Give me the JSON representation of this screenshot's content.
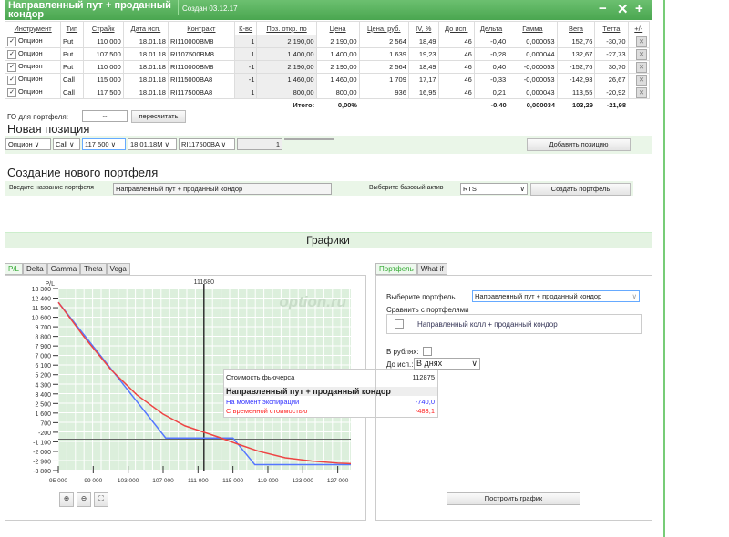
{
  "header": {
    "title": "Направленный пут + проданный кондор",
    "created": "Создан 03.12.17"
  },
  "table": {
    "columns": [
      "Инструмент",
      "Тип",
      "Страйк",
      "Дата исп.",
      "Контракт",
      "К-во",
      "Поз. откр. по",
      "Цена",
      "Цена, руб.",
      "IV, %",
      "До исп.",
      "Дельта",
      "Гамма",
      "Вега",
      "Тетта",
      "+/-"
    ],
    "rows": [
      [
        "Опцион",
        "Put",
        "110 000",
        "18.01.18",
        "RI110000BM8",
        "1",
        "2 190,00",
        "2 190,00",
        "2 564",
        "18,49",
        "46",
        "-0,40",
        "0,000053",
        "152,76",
        "-30,70"
      ],
      [
        "Опцион",
        "Put",
        "107 500",
        "18.01.18",
        "RI107500BM8",
        "1",
        "1 400,00",
        "1 400,00",
        "1 639",
        "19,23",
        "46",
        "-0,28",
        "0,000044",
        "132,67",
        "-27,73"
      ],
      [
        "Опцион",
        "Put",
        "110 000",
        "18.01.18",
        "RI110000BM8",
        "-1",
        "2 190,00",
        "2 190,00",
        "2 564",
        "18,49",
        "46",
        "0,40",
        "-0,000053",
        "-152,76",
        "30,70"
      ],
      [
        "Опцион",
        "Call",
        "115 000",
        "18.01.18",
        "RI115000BA8",
        "-1",
        "1 460,00",
        "1 460,00",
        "1 709",
        "17,17",
        "46",
        "-0,33",
        "-0,000053",
        "-142,93",
        "26,67"
      ],
      [
        "Опцион",
        "Call",
        "117 500",
        "18.01.18",
        "RI117500BA8",
        "1",
        "800,00",
        "800,00",
        "936",
        "16,95",
        "46",
        "0,21",
        "0,000043",
        "113,55",
        "-20,92"
      ]
    ],
    "total_label": "Итого:",
    "total_pct": "0,00%",
    "total_delta": "-0,40",
    "total_gamma": "0,000034",
    "total_vega": "103,29",
    "total_theta": "-21,98"
  },
  "go": {
    "label": "ГО для портфеля:",
    "value": "--",
    "recalc": "пересчитать"
  },
  "new_position": {
    "title": "Новая позиция",
    "instrument": "Опцион",
    "type": "Call",
    "strike": "117 500",
    "date": "18.01.18M",
    "contract": "RI117500BA",
    "qty": "1",
    "add": "Добавить позицию"
  },
  "new_portfolio": {
    "title": "Создание нового портфеля",
    "name_label": "Введите название портфеля",
    "name_value": "Направленный пут + проданный кондор",
    "asset_label": "Выберите базовый актив",
    "asset": "RTS",
    "create": "Создать портфель"
  },
  "charts": {
    "title": "Графики",
    "tabs": [
      "P/L",
      "Delta",
      "Gamma",
      "Theta",
      "Vega"
    ],
    "zoom_icons": [
      "zoom-in",
      "zoom-out",
      "zoom-fit"
    ]
  },
  "chart_data": {
    "type": "line",
    "ylabel": "P/L",
    "watermark": "option.ru",
    "marker": "111680",
    "yticks": [
      13300,
      12400,
      11500,
      10600,
      9700,
      8800,
      7900,
      7000,
      6100,
      5200,
      4300,
      3400,
      2500,
      1600,
      700,
      -200,
      -1100,
      -2000,
      -2900,
      -3800
    ],
    "ytick_labels": [
      "13 300",
      "12 400",
      "11 500",
      "10 600",
      "9 700",
      "8 800",
      "7 900",
      "7 000",
      "6 100",
      "5 200",
      "4 300",
      "3 400",
      "2 500",
      "1 600",
      "700",
      "-200",
      "-1 100",
      "-2 000",
      "-2 900",
      "-3 800"
    ],
    "xticks": [
      95000,
      99000,
      103000,
      107000,
      111000,
      115000,
      119000,
      123000,
      127000
    ],
    "xtick_labels": [
      "95 000",
      "99 000",
      "103 000",
      "107 000",
      "111 000",
      "115 000",
      "119 000",
      "123 000",
      "127 000"
    ],
    "xlim": [
      95000,
      128500
    ],
    "ylim": [
      -3800,
      13300
    ],
    "series": [
      {
        "name": "На момент экспирации",
        "color": "#5577ff",
        "x": [
          95000,
          107300,
          115000,
          117500,
          128500
        ],
        "y": [
          12000,
          -740,
          -740,
          -3240,
          -3240
        ]
      },
      {
        "name": "С временной стоимостью",
        "color": "#ee4444",
        "x": [
          95000,
          98000,
          101000,
          104000,
          107000,
          109500,
          111680,
          113500,
          115500,
          118000,
          121000,
          124000,
          127000,
          128500
        ],
        "y": [
          12000,
          8700,
          5700,
          3300,
          1500,
          400,
          -200,
          -700,
          -1300,
          -2000,
          -2600,
          -2900,
          -3100,
          -3150
        ]
      }
    ],
    "tooltip": {
      "label": "Стоимость фьючерса",
      "x": "112875",
      "title": "Направленный пут + проданный кондор",
      "expiry_label": "На момент экспирации",
      "expiry_value": "-740,0",
      "time_label": "С временной стоимостью",
      "time_value": "-483,1"
    }
  },
  "side": {
    "tabs": [
      "Портфель",
      "What if"
    ],
    "select_label": "Выберите портфель",
    "select_value": "Направленный пут + проданный кондор",
    "compare_label": "Сравнить с портфелями",
    "compare_item": "Направленный колл + проданный кондор",
    "rub_label": "В рублях:",
    "exp_label": "До исп.:",
    "exp_value": "В днях",
    "build": "Построить график"
  }
}
